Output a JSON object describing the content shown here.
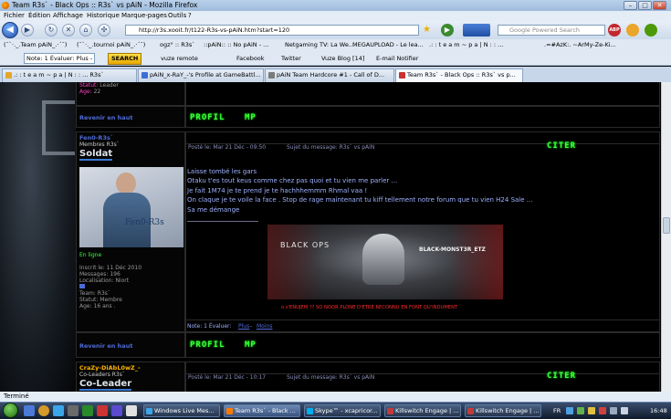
{
  "window": {
    "title": "Team R3s` - Black Ops :: R3s` vs pAiN - Mozilla Firefox"
  },
  "menu": [
    "Fichier",
    "Édition",
    "Affichage",
    "Historique",
    "Marque-pages",
    "Outils",
    "?"
  ],
  "address": {
    "url": "http://r3s.xooit.fr/t122-R3s-vs-pAiN.htm?start=120"
  },
  "search": {
    "placeholder": "Google Powered Search"
  },
  "bookmarks": [
    "(¯`·._.Team pAiN_.·´¯)",
    "(¯`·._.tournoi pAiN_.·´¯)",
    "ogz° :: R3s`",
    "::pAiN:: :: No pAiN - ...",
    "Netgaming TV: La We...",
    "MEGAUPLOAD - Le lea...",
    ".: : t e a m ~ p a | N : : ...",
    ".=#AzK:. ~ArMy-Ze-Ki..."
  ],
  "toolbar": {
    "note": "Note: 1  Évaluer: Plus -",
    "search_btn": "SEARCH",
    "vuze": "vuze remote",
    "facebook": "Facebook",
    "twitter": "Twitter",
    "vuzeblog": "Vuze Blog [14]",
    "email": "E-mail Notifier"
  },
  "tabs": [
    {
      "label": ".: : t e a m ~ p a | N : : ... R3s`",
      "active": false
    },
    {
      "label": "pAiN_x-RaY_-'s Profile at GameBattl...",
      "active": false
    },
    {
      "label": "pAiN Team Hardcore #1 - Call of D...",
      "active": false
    },
    {
      "label": "Team R3s` - Black Ops :: R3s` vs p...",
      "active": true
    }
  ],
  "post_top": {
    "status_label": "Statut:",
    "status": "Leader",
    "age_label": "Age:",
    "age": "22",
    "back_top": "Revenir en haut",
    "profil": "PROFIL",
    "mp": "MP"
  },
  "post1": {
    "username": "Fen0-R3s`",
    "role": "Membres R3s`",
    "rank": "Soldat",
    "avatar_text": "Fen0-R3s",
    "online": "En ligne",
    "inscrit": "Inscrit le: 11 Déc 2010",
    "messages": "Messages: 196",
    "localisation": "Localisation: Niort",
    "team": "Team: R3s`",
    "statut": "Statut: Membre",
    "age": "Age: 16 ans .",
    "posted": "Posté le: Mar 21 Déc - 09:50",
    "subject": "Sujet du message: R3s` vs pAiN",
    "quote": "CITER",
    "lines": [
      "Laisse tombé les gars",
      "Otaku t'es tout keus comme chez pas quoi et tu vien me parler  ...",
      "Je fait 1M74 je te prend je te hachhhemmm Rhmal vaa !",
      "On claque je te voile la face . Stop de rage maintenant tu kiff tellement notre forum que tu vien H24 Sale ...",
      "Sa me démange"
    ],
    "banner_left": "BLACK OPS",
    "banner_right": "BLACK-MONST3R_ETZ",
    "banner_caption": "o s'ENUJEM ?? SO NOOR PLONE D'ETRE RECONNU EN FONT QU'INDUMENT",
    "note": "Note: 1   Évaluer:",
    "plus": "Plus",
    "moins": "Moins",
    "back_top": "Revenir en haut",
    "profil": "PROFIL",
    "mp": "MP"
  },
  "post2": {
    "username": "CraZy-DiAbL0wZ_-",
    "role": "Co-Leaders R3s`",
    "rank": "Co-Leader",
    "posted": "Posté le: Mar 21 Déc - 10:17",
    "subject": "Sujet du message: R3s` vs pAiN",
    "quote": "CITER"
  },
  "status": {
    "text": "Terminé"
  },
  "taskbar": [
    {
      "label": "Windows Live Mes...",
      "color": "#3aa5e8"
    },
    {
      "label": "Team R3s` - Black ...",
      "color": "#ff7b00"
    },
    {
      "label": "Skype™ - xcapricor...",
      "color": "#00aff0"
    },
    {
      "label": "Killswitch Engage | ...",
      "color": "#c23b3b"
    },
    {
      "label": "Killswitch Engage | ...",
      "color": "#c23b3b"
    }
  ],
  "tray": {
    "lang": "FR",
    "time": "16:48"
  }
}
